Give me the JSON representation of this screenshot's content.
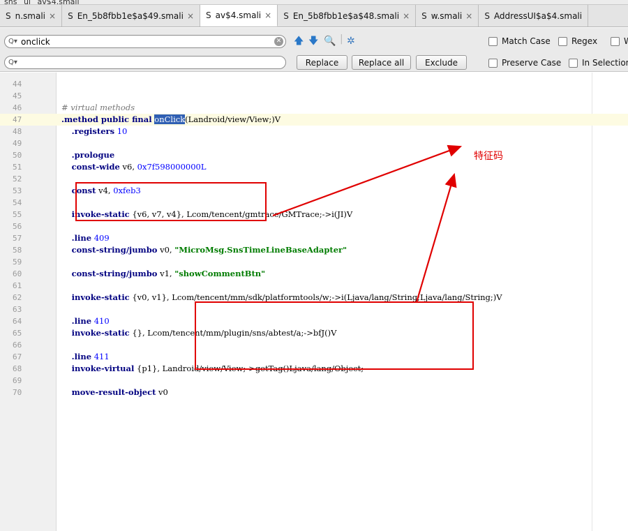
{
  "breadcrumb": [
    "sns",
    "ui",
    "av$4.smali"
  ],
  "tabs": [
    {
      "icon": "S",
      "label": "n.smali",
      "active": false
    },
    {
      "icon": "S",
      "label": "En_5b8fbb1e$a$49.smali",
      "active": false
    },
    {
      "icon": "S",
      "label": "av$4.smali",
      "active": true
    },
    {
      "icon": "S",
      "label": "En_5b8fbb1e$a$48.smali",
      "active": false
    },
    {
      "icon": "S",
      "label": "w.smali",
      "active": false
    },
    {
      "icon": "S",
      "label": "AddressUI$a$4.smali",
      "active": false
    }
  ],
  "find": {
    "search_prefix": "Q▾",
    "search_value": "onclick",
    "replace_prefix": "Q▾",
    "replace_value": "",
    "replace_label": "Replace",
    "replace_all_label": "Replace all",
    "exclude_label": "Exclude",
    "match_case_label": "Match Case",
    "regex_label": "Regex",
    "words_label": "W",
    "preserve_case_label": "Preserve Case",
    "in_selection_label": "In Selection"
  },
  "code": {
    "lines": [
      {
        "n": "44",
        "t": ""
      },
      {
        "n": "45",
        "t": ""
      },
      {
        "n": "46",
        "t": "# virtual methods"
      },
      {
        "n": "47",
        "t": ".method public final onClick(Landroid/view/View;)V"
      },
      {
        "n": "48",
        "t": "    .registers 10"
      },
      {
        "n": "49",
        "t": ""
      },
      {
        "n": "50",
        "t": "    .prologue"
      },
      {
        "n": "51",
        "t": "    const-wide v6, 0x7f598000000L"
      },
      {
        "n": "52",
        "t": ""
      },
      {
        "n": "53",
        "t": "    const v4, 0xfeb3"
      },
      {
        "n": "54",
        "t": ""
      },
      {
        "n": "55",
        "t": "    invoke-static {v6, v7, v4}, Lcom/tencent/gmtrace/GMTrace;->i(JI)V"
      },
      {
        "n": "56",
        "t": ""
      },
      {
        "n": "57",
        "t": "    .line 409"
      },
      {
        "n": "58",
        "t": "    const-string/jumbo v0, \"MicroMsg.SnsTimeLineBaseAdapter\""
      },
      {
        "n": "59",
        "t": ""
      },
      {
        "n": "60",
        "t": "    const-string/jumbo v1, \"showCommentBtn\""
      },
      {
        "n": "61",
        "t": ""
      },
      {
        "n": "62",
        "t": "    invoke-static {v0, v1}, Lcom/tencent/mm/sdk/platformtools/w;->i(Ljava/lang/String;Ljava/lang/String;)V"
      },
      {
        "n": "63",
        "t": ""
      },
      {
        "n": "64",
        "t": "    .line 410"
      },
      {
        "n": "65",
        "t": "    invoke-static {}, Lcom/tencent/mm/plugin/sns/abtest/a;->bfJ()V"
      },
      {
        "n": "66",
        "t": ""
      },
      {
        "n": "67",
        "t": "    .line 411"
      },
      {
        "n": "68",
        "t": "    invoke-virtual {p1}, Landroid/view/View;->getTag()Ljava/lang/Object;"
      },
      {
        "n": "69",
        "t": ""
      },
      {
        "n": "70",
        "t": "    move-result-object v0"
      }
    ]
  },
  "annotation": {
    "label": "特征码",
    "color": "#e00000"
  },
  "colors": {
    "keyword": "#000080",
    "number": "#0000ff",
    "string": "#007c00",
    "selection": "#2f5fb3",
    "current_line": "#fdfbe2"
  }
}
